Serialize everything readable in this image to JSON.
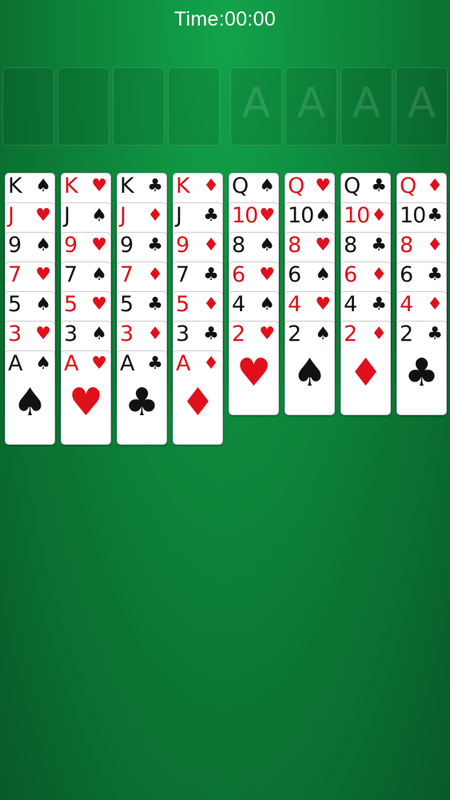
{
  "timer": "Time:00:00",
  "free_cells": 4,
  "foundations": [
    {
      "label": "A"
    },
    {
      "label": "A"
    },
    {
      "label": "A"
    },
    {
      "label": "A"
    }
  ],
  "suit_colors": {
    "red": "#e0101b",
    "black": "#111111"
  },
  "table_color": "#0e8a3e",
  "tableau": [
    [
      {
        "rank": "K",
        "suit": "♠"
      },
      {
        "rank": "J",
        "suit": "♥"
      },
      {
        "rank": "9",
        "suit": "♠"
      },
      {
        "rank": "7",
        "suit": "♥"
      },
      {
        "rank": "5",
        "suit": "♠"
      },
      {
        "rank": "3",
        "suit": "♥"
      },
      {
        "rank": "A",
        "suit": "♠"
      }
    ],
    [
      {
        "rank": "K",
        "suit": "♥"
      },
      {
        "rank": "J",
        "suit": "♠"
      },
      {
        "rank": "9",
        "suit": "♥"
      },
      {
        "rank": "7",
        "suit": "♠"
      },
      {
        "rank": "5",
        "suit": "♥"
      },
      {
        "rank": "3",
        "suit": "♠"
      },
      {
        "rank": "A",
        "suit": "♥"
      }
    ],
    [
      {
        "rank": "K",
        "suit": "♣"
      },
      {
        "rank": "J",
        "suit": "♦"
      },
      {
        "rank": "9",
        "suit": "♣"
      },
      {
        "rank": "7",
        "suit": "♦"
      },
      {
        "rank": "5",
        "suit": "♣"
      },
      {
        "rank": "3",
        "suit": "♦"
      },
      {
        "rank": "A",
        "suit": "♣"
      }
    ],
    [
      {
        "rank": "K",
        "suit": "♦"
      },
      {
        "rank": "J",
        "suit": "♣"
      },
      {
        "rank": "9",
        "suit": "♦"
      },
      {
        "rank": "7",
        "suit": "♣"
      },
      {
        "rank": "5",
        "suit": "♦"
      },
      {
        "rank": "3",
        "suit": "♣"
      },
      {
        "rank": "A",
        "suit": "♦"
      }
    ],
    [
      {
        "rank": "Q",
        "suit": "♠"
      },
      {
        "rank": "10",
        "suit": "♥"
      },
      {
        "rank": "8",
        "suit": "♠"
      },
      {
        "rank": "6",
        "suit": "♥"
      },
      {
        "rank": "4",
        "suit": "♠"
      },
      {
        "rank": "2",
        "suit": "♥"
      }
    ],
    [
      {
        "rank": "Q",
        "suit": "♥"
      },
      {
        "rank": "10",
        "suit": "♠"
      },
      {
        "rank": "8",
        "suit": "♥"
      },
      {
        "rank": "6",
        "suit": "♠"
      },
      {
        "rank": "4",
        "suit": "♥"
      },
      {
        "rank": "2",
        "suit": "♠"
      }
    ],
    [
      {
        "rank": "Q",
        "suit": "♣"
      },
      {
        "rank": "10",
        "suit": "♦"
      },
      {
        "rank": "8",
        "suit": "♣"
      },
      {
        "rank": "6",
        "suit": "♦"
      },
      {
        "rank": "4",
        "suit": "♣"
      },
      {
        "rank": "2",
        "suit": "♦"
      }
    ],
    [
      {
        "rank": "Q",
        "suit": "♦"
      },
      {
        "rank": "10",
        "suit": "♣"
      },
      {
        "rank": "8",
        "suit": "♦"
      },
      {
        "rank": "6",
        "suit": "♣"
      },
      {
        "rank": "4",
        "suit": "♦"
      },
      {
        "rank": "2",
        "suit": "♣"
      }
    ]
  ]
}
